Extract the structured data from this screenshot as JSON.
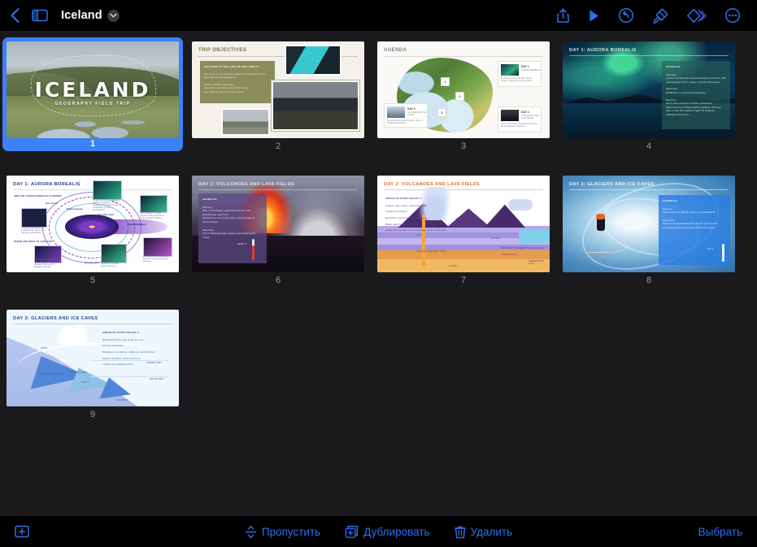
{
  "app": {
    "background_color": "#1a1a1c",
    "accent_color": "#2f6fed",
    "selection_color": "#3b82f6"
  },
  "topbar": {
    "back_icon": "chevron-left-icon",
    "sidebar_icon": "sidebar-toggle-icon",
    "title": "Iceland",
    "title_menu_icon": "chevron-down-icon",
    "actions": [
      {
        "name": "share-icon",
        "label": "Share"
      },
      {
        "name": "play-icon",
        "label": "Play"
      },
      {
        "name": "undo-icon",
        "label": "Undo"
      },
      {
        "name": "format-brush-icon",
        "label": "Format"
      },
      {
        "name": "animate-icon",
        "label": "Animate"
      },
      {
        "name": "more-icon",
        "label": "More"
      }
    ]
  },
  "slides": [
    {
      "number": "1",
      "selected": true,
      "kind": "cover",
      "title": "ICELAND",
      "subtitle": "GEOGRAPHY FIELD TRIP"
    },
    {
      "number": "2",
      "selected": false,
      "kind": "objectives",
      "title": "TRIP OBJECTIVES",
      "box_heading": "WELCOME TO THE LAND OF FIRE AND ICE",
      "box_intro": "The aims of this field trip exploring Iceland's unique geology and geography are:",
      "bullets": [
        "Gather primary field data",
        "Research specialist subject for essay",
        "Use data as basis for coursework"
      ]
    },
    {
      "number": "3",
      "selected": false,
      "kind": "agenda",
      "title": "AGENDA",
      "pins": [
        "1",
        "2",
        "3"
      ],
      "cards": [
        {
          "day": "DAY 1",
          "name": "AURORA BOREALIS",
          "body": "Lecture on aurora borealis. Aurora displays. Viewing of northern lights"
        },
        {
          "day": "DAY 2",
          "name": "VOLCANOES AND LAVA FIELDS",
          "body": "Visit to Holuhraun and Bardarbunga lava fields. Black sand beaches"
        },
        {
          "day": "DAY 3",
          "name": "GLACIERS AND ICE CAVES",
          "body": "Sail across Jokulsarlon lagoon. Hike on Eyjafjallajokull glacier"
        }
      ]
    },
    {
      "number": "4",
      "selected": false,
      "kind": "day1-photo",
      "title": "DAY 1: AURORA BOREALIS",
      "panel_heading": "SCHEDULE",
      "sections": [
        {
          "label": "Morning:",
          "items": [
            "Lecture on how the aurora borealis is formed, with geomagnetic storm expert Jennifer Sorensen"
          ]
        },
        {
          "label": "Afternoon:",
          "items": [
            "Exhibition on aurora photography"
          ]
        },
        {
          "label": "Evening:",
          "items": [
            "Drive from Akureyri into the mountains",
            "Night tour for northern lights spotting: the best time to see the northern lights is between midnight and 2 a.m."
          ]
        }
      ]
    },
    {
      "number": "5",
      "selected": false,
      "kind": "aurora-diagram",
      "title": "DAY 1: AURORA BOREALIS",
      "subheading_1": "HOW THE AURORA BOREALIS IS FORMED",
      "subheading_2": "WHERE AND WHAT TO LOOK FOR",
      "labels": [
        "Bow shock",
        "Magnetopause",
        "Solar wind",
        "Van Allen belts",
        "Plasma sheet",
        "Closed field lines",
        "Auroral oval",
        "Tail"
      ],
      "callouts": [
        "Charged particles are emitted from the sun during a solar flare",
        "These particles penetrate Earth's magnetic shield, colliding with atoms and molecules on our atmosphere",
        "The collisions create photons that appear as light-colored curtains",
        "Aurora borealis and commonly seen as between 60 and 75 degrees latitude",
        "Collisions with oxygen produce cool and green auroras",
        "Collisions with nitrogen produce pink and purple auroras"
      ]
    },
    {
      "number": "6",
      "selected": false,
      "kind": "day2-photo",
      "title": "DAY 2: VOLCANOES AND LAVA FIELDS",
      "panel_heading": "SCHEDULE",
      "temperature": "2010° F",
      "sections": [
        {
          "label": "Morning:",
          "items": [
            "Visit to Holuhraun lava field and the new Nornahraun lava field",
            "Guided tour of a crater with volcanologist Dr. Grant Phelps"
          ]
        },
        {
          "label": "Afternoon:",
          "items": [
            "Trip to Bardarbunga volcano and black sand beach"
          ]
        }
      ]
    },
    {
      "number": "7",
      "selected": false,
      "kind": "volcano-diagram",
      "title": "DAY 2: VOLCANOES AND LAVA FIELDS",
      "subheading": "AREAS OF STUDY ON DAY 2",
      "bullets": [
        "Craters, lava tubes, and lava fields",
        "Volcano formation",
        "Eruptions, fissures, and structure",
        "Black sand beach formation",
        "Impacts lava fields and volcanoes have on the land"
      ],
      "labels": [
        "VOLCANIC ASH",
        "LAVA",
        "ASH CLOUD",
        "CRATER",
        "MAGMA",
        "VOLCANIC SEDIMENT ROCK",
        "METAMORPHIC ROCK",
        "SEDIMENTARY ROCK",
        "IGNEOUS ROCK",
        "GEOTHERMAL WATER",
        "SEDIMENTARY ROCK"
      ]
    },
    {
      "number": "8",
      "selected": false,
      "kind": "day3-photo",
      "title": "DAY 3: GLACIERS AND ICE CAVES",
      "panel_heading": "SCHEDULE",
      "temperature": "14° F",
      "sections": [
        {
          "label": "Morning:",
          "items": [
            "Sail across the glacial lagoon of Jokulsarlon"
          ]
        },
        {
          "label": "Afternoon:",
          "items": [
            "Hike on the Eyjafjallajokull glacier and volcano",
            "Ice climbing demonstration with Kevin Kigel"
          ]
        }
      ]
    },
    {
      "number": "9",
      "selected": false,
      "kind": "glacier-diagram",
      "title": "DAY 3: GLACIERS AND ICE CAVES",
      "subheading": "AREAS OF STUDY ON DAY 3",
      "bullets": [
        "Determining the age of an ice core",
        "Glacier formation",
        "Moraines, crevasses, calderas, and fissures",
        "Glacier behavior and movement",
        "Impact on coastline levels"
      ],
      "labels": [
        "SNOW",
        "ACCUMULATION ZONE",
        "ABLATION ZONE",
        "SNOUT",
        "ICE SHELF",
        "SUMMER MELT",
        "WINTER MELT",
        "LEVEL OF ICE"
      ]
    }
  ],
  "bottombar": {
    "add_icon": "add-slide-icon",
    "add_label": "Add slide",
    "actions": [
      {
        "icon": "skip-slide-icon",
        "label": "Пропустить"
      },
      {
        "icon": "duplicate-icon",
        "label": "Дублировать"
      },
      {
        "icon": "trash-icon",
        "label": "Удалить"
      }
    ],
    "select_label": "Выбрать"
  }
}
